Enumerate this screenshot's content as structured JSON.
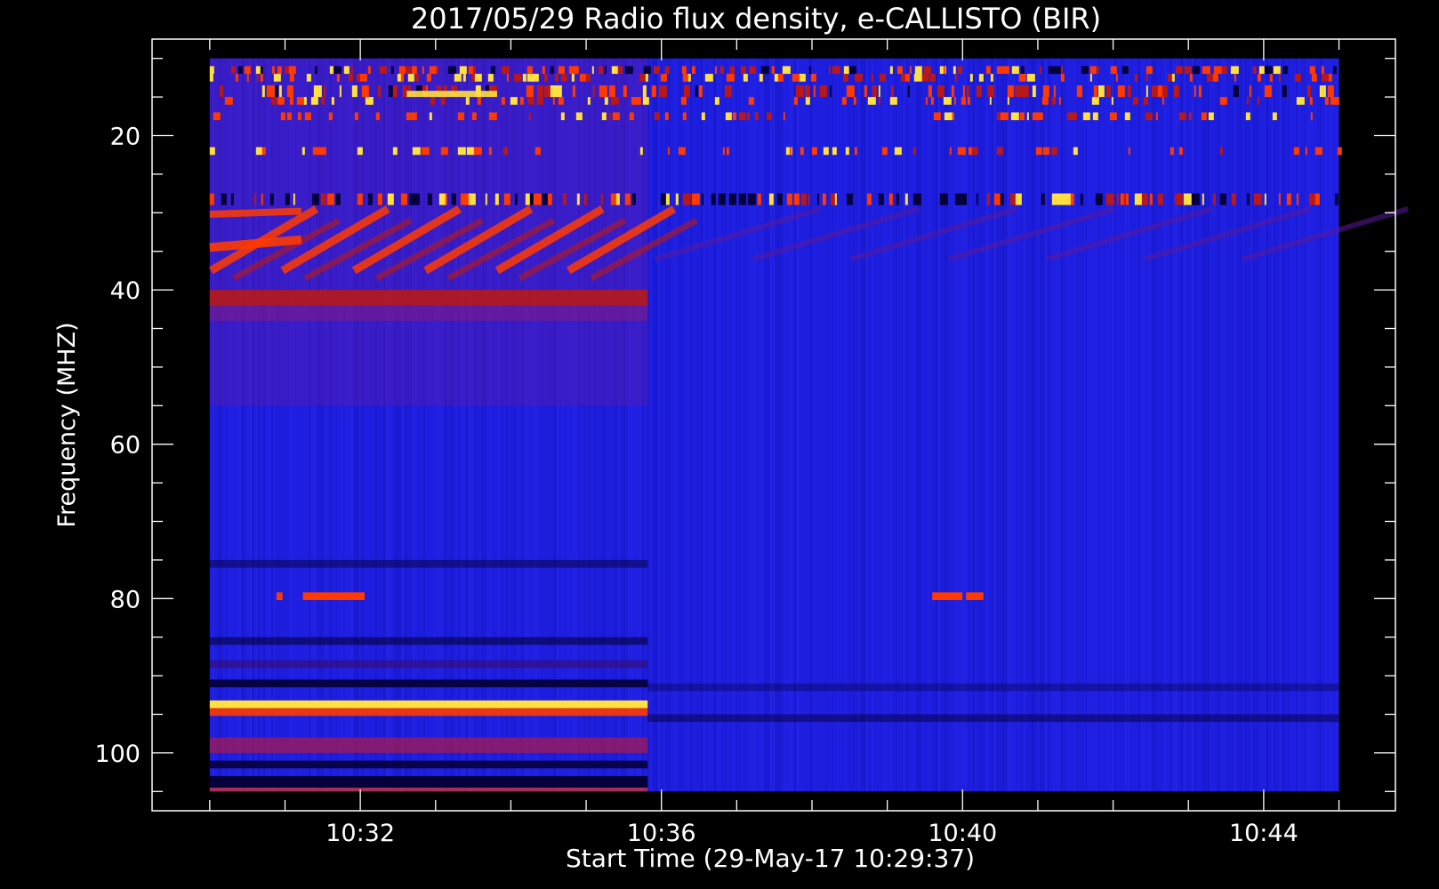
{
  "chart_data": {
    "type": "heatmap",
    "title": "2017/05/29  Radio flux density, e-CALLISTO (BIR)",
    "xlabel": "Start Time (29-May-17 10:29:37)",
    "ylabel": "Frequency (MHZ)",
    "x_ticks": [
      "10:32",
      "10:36",
      "10:40",
      "10:44"
    ],
    "x_tick_minutes": [
      2.383,
      6.383,
      10.383,
      14.383
    ],
    "x_minor_tick_minutes": [
      0.383,
      1.383,
      3.383,
      4.383,
      5.383,
      7.383,
      8.383,
      9.383,
      11.383,
      12.383,
      13.383,
      15.383
    ],
    "xlim_minutes": [
      -0.383,
      16.133
    ],
    "data_x_extent_minutes": [
      0.383,
      15.383
    ],
    "y_ticks": [
      20,
      40,
      60,
      80,
      100
    ],
    "y_minor_ticks": [
      10,
      15,
      25,
      30,
      35,
      45,
      50,
      55,
      65,
      70,
      75,
      85,
      90,
      95,
      105
    ],
    "ylim": [
      107.5,
      7.5
    ],
    "y_inverted": true,
    "data_y_extent": [
      10,
      105
    ],
    "colors": {
      "background": "#000000",
      "frame": "#ffffff",
      "quiet": "#1e1ee0",
      "dark": "#05003a",
      "moderate": "#b81818",
      "strong": "#ff3a00",
      "intense": "#ffe040"
    }
  }
}
